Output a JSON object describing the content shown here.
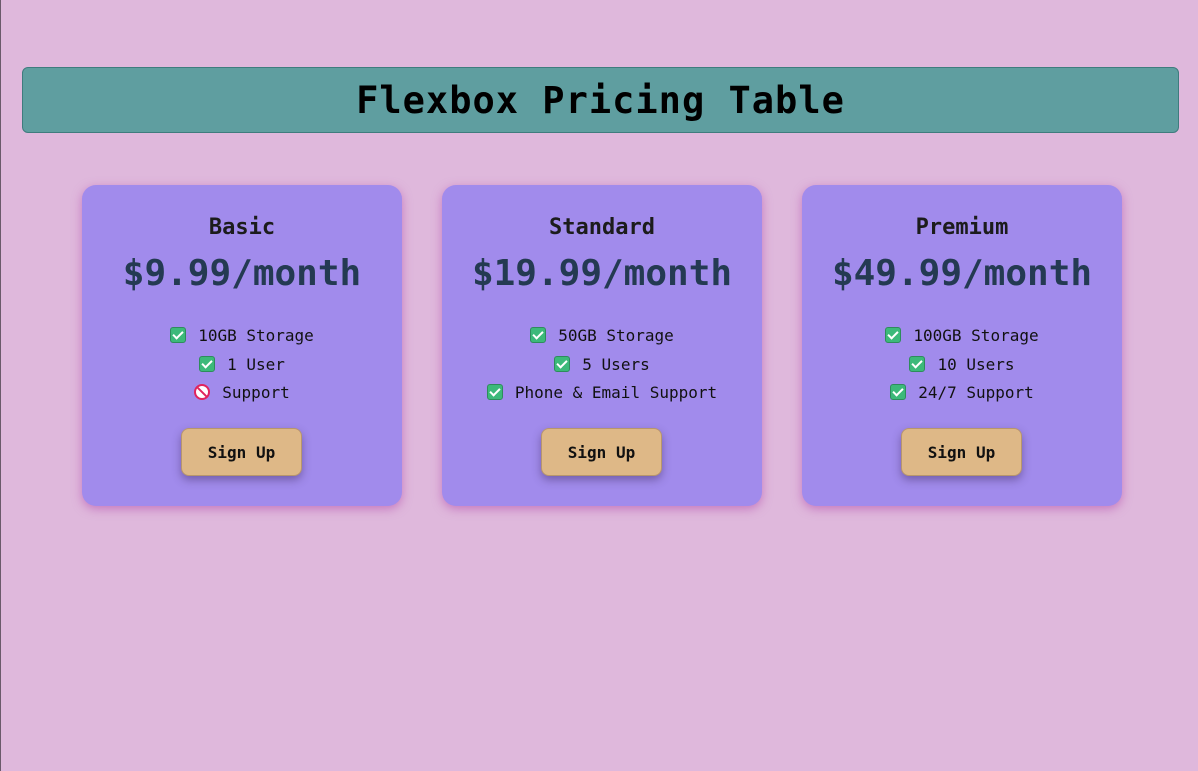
{
  "header": {
    "title": "Flexbox Pricing Table"
  },
  "plans": [
    {
      "name": "Basic",
      "price": "$9.99/month",
      "features": [
        {
          "text": "10GB Storage",
          "icon": "check-icon"
        },
        {
          "text": "1 User",
          "icon": "check-icon"
        },
        {
          "text": "Support",
          "icon": "prohibited-icon"
        }
      ],
      "button_label": "Sign Up"
    },
    {
      "name": "Standard",
      "price": "$19.99/month",
      "features": [
        {
          "text": "50GB Storage",
          "icon": "check-icon"
        },
        {
          "text": "5 Users",
          "icon": "check-icon"
        },
        {
          "text": "Phone & Email Support",
          "icon": "check-icon"
        }
      ],
      "button_label": "Sign Up"
    },
    {
      "name": "Premium",
      "price": "$49.99/month",
      "features": [
        {
          "text": "100GB Storage",
          "icon": "check-icon"
        },
        {
          "text": "10 Users",
          "icon": "check-icon"
        },
        {
          "text": "24/7 Support",
          "icon": "check-icon"
        }
      ],
      "button_label": "Sign Up"
    }
  ],
  "colors": {
    "background": "#dfb8dc",
    "header": "#5f9ea0",
    "card": "#a18bec",
    "price": "#243a52",
    "button": "#deb887",
    "check": "#3cb97a",
    "prohibited": "#e0245e"
  }
}
